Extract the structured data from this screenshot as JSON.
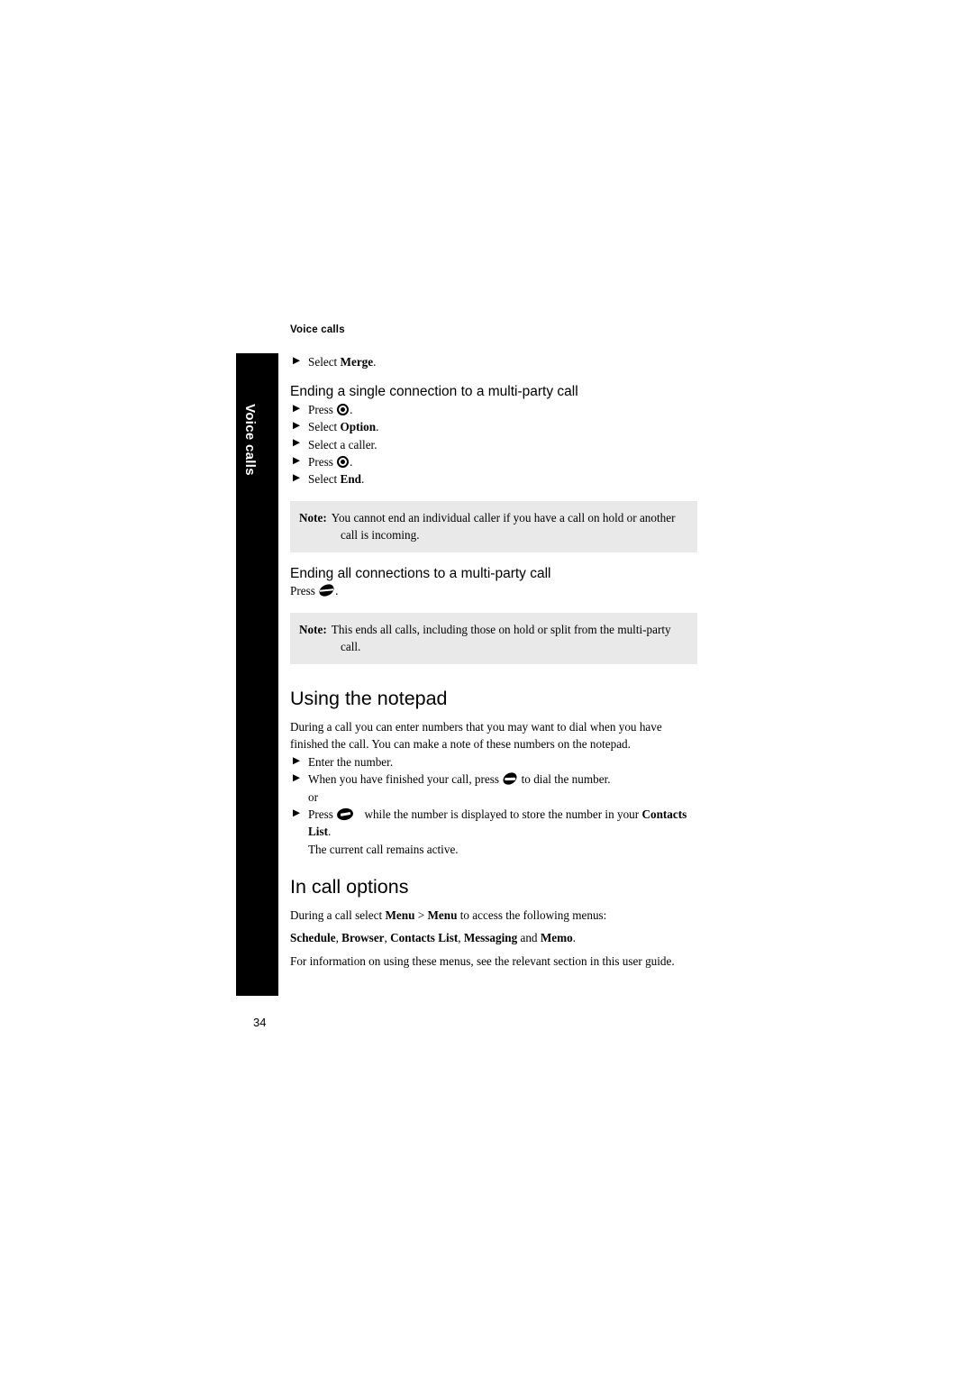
{
  "document": {
    "running_head": "Voice calls",
    "page_number": "34",
    "side_tab_label": "Voice calls"
  },
  "sections": {
    "merge_step": {
      "prefix": "Select ",
      "bold": "Merge",
      "suffix": "."
    },
    "ending_single": {
      "heading": "Ending a single connection to a multi-party call",
      "steps": [
        {
          "prefix": "Press ",
          "icon": "nav-key-icon",
          "suffix": "."
        },
        {
          "prefix": "Select ",
          "bold": "Option",
          "suffix": "."
        },
        {
          "prefix": "Select a caller.",
          "bold": "",
          "suffix": ""
        },
        {
          "prefix": "Press ",
          "icon": "nav-key-icon",
          "suffix": "."
        },
        {
          "prefix": "Select ",
          "bold": "End",
          "suffix": "."
        }
      ],
      "note": {
        "label": "Note:",
        "text": "You cannot end an individual caller if you have a call on hold or another call is incoming."
      }
    },
    "ending_all": {
      "heading": "Ending all connections to a multi-party call",
      "press_prefix": "Press ",
      "press_icon": "end-call-key-icon",
      "press_suffix": ".",
      "note": {
        "label": "Note:",
        "text": "This ends all calls, including those on hold or split from the multi-party call."
      }
    },
    "notepad": {
      "heading": "Using the notepad",
      "intro": "During a call you can enter numbers that you may want to dial when you have finished the call. You can make a note of these numbers on the notepad.",
      "step1": "Enter the number.",
      "step2_prefix": "When you have finished your call, press ",
      "step2_icon": "dial-key-icon",
      "step2_suffix": " to dial the number.",
      "or_label": "or",
      "step3_prefix": "Press ",
      "step3_icon": "store-key-icon",
      "step3_middle": " while the number is displayed to store the number in your ",
      "step3_bold": "Contacts List",
      "step3_suffix": ".",
      "step3_line2": "The current call remains active."
    },
    "in_call_options": {
      "heading": "In call options",
      "line1_prefix": "During a call select ",
      "line1_bold1": "Menu",
      "line1_sep": " > ",
      "line1_bold2": "Menu",
      "line1_suffix": " to access the following menus:",
      "menu_items": [
        "Schedule",
        "Browser",
        "Contacts List",
        "Messaging",
        "Memo"
      ],
      "menu_separator": ", ",
      "menu_conjunction": " and ",
      "menu_terminator": ".",
      "line3": "For information on using these menus, see the relevant section in this user guide."
    }
  },
  "colors": {
    "note_background": "#e9e9e9",
    "tab_background": "#000000",
    "text": "#000000"
  }
}
